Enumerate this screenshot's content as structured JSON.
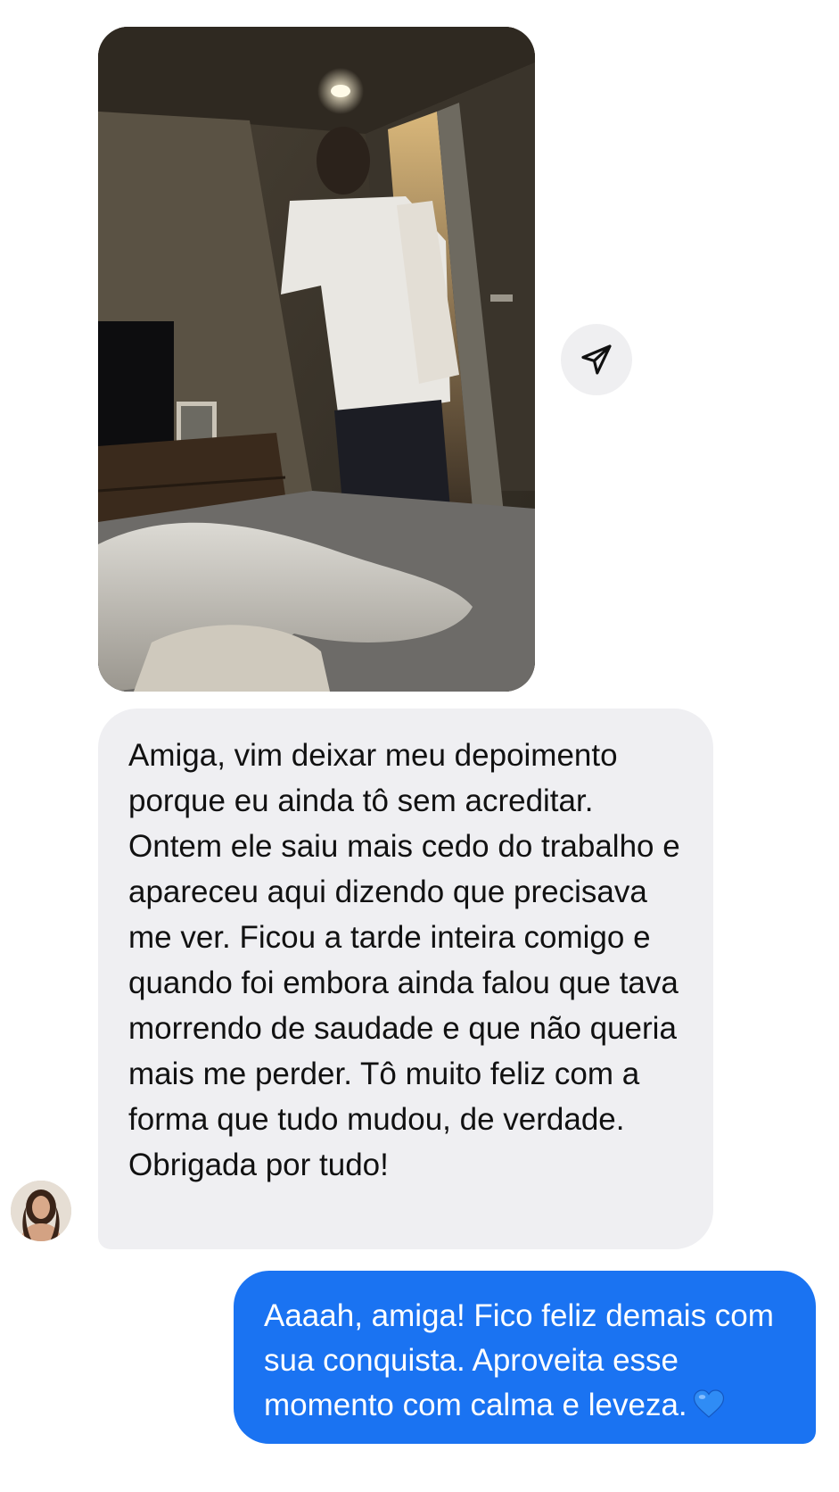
{
  "conversation": {
    "photo_message": {
      "image_description": "photo-message",
      "share_icon": "paper-plane-icon"
    },
    "incoming_message": {
      "text": "Amiga, vim deixar meu depoimento porque eu ainda tô sem acreditar. Ontem ele saiu mais cedo do trabalho e apareceu aqui dizendo que precisava me ver. Ficou a tarde inteira comigo e quando foi embora ainda falou que tava morrendo de saudade e que não queria mais me perder. Tô muito feliz com a forma que tudo mudou, de verdade. Obrigada por tudo!"
    },
    "outgoing_message": {
      "text": "Aaaah, amiga! Fico feliz demais com sua conquista. Aproveita esse momento com calma e leveza.",
      "emoji_icon": "blue-heart-icon"
    },
    "colors": {
      "incoming_bubble": "#efeff2",
      "outgoing_bubble": "#1a73f2",
      "share_button": "#efeff1"
    }
  }
}
